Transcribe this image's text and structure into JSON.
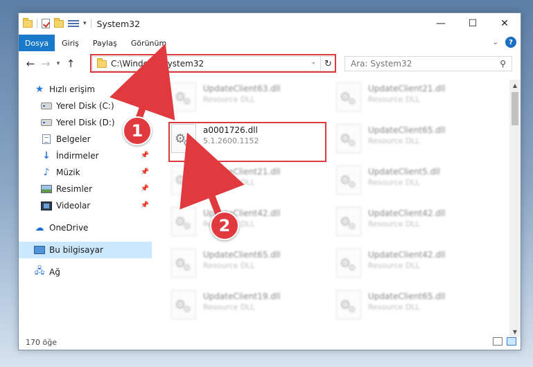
{
  "window": {
    "title": "System32",
    "controls": {
      "minimize": "—",
      "maximize": "☐",
      "close": "✕"
    }
  },
  "ribbon": {
    "tabs": [
      "Dosya",
      "Giriş",
      "Paylaş",
      "Görünüm"
    ],
    "help": "?"
  },
  "address": {
    "path": "C:\\Windows\\System32",
    "search_placeholder": "Ara: System32"
  },
  "sidebar": {
    "items": [
      {
        "label": "Hızlı erişim",
        "icon": "star-icon"
      },
      {
        "label": "Yerel Disk (C:)",
        "icon": "disk-icon"
      },
      {
        "label": "Yerel Disk (D:)",
        "icon": "disk-icon"
      },
      {
        "label": "Belgeler",
        "icon": "documents-icon"
      },
      {
        "label": "İndirmeler",
        "icon": "download-icon"
      },
      {
        "label": "Müzik",
        "icon": "music-icon"
      },
      {
        "label": "Resimler",
        "icon": "pictures-icon"
      },
      {
        "label": "Videolar",
        "icon": "videos-icon"
      },
      {
        "label": "OneDrive",
        "icon": "cloud-icon"
      },
      {
        "label": "Bu bilgisayar",
        "icon": "computer-icon"
      },
      {
        "label": "Ağ",
        "icon": "network-icon"
      }
    ]
  },
  "files": {
    "left": [
      {
        "name": "UpdateClient63.dll",
        "sub": "Resource DLL"
      },
      {
        "name": "a0001726.dll",
        "sub": "5.1.2600.1152"
      },
      {
        "name": "UpdateClient21.dll",
        "sub": "Resource DLL"
      },
      {
        "name": "UpdateClient42.dll",
        "sub": "Resource DLL"
      },
      {
        "name": "UpdateClient65.dll",
        "sub": "Resource DLL"
      },
      {
        "name": "UpdateClient19.dll",
        "sub": "Resource DLL"
      }
    ],
    "right": [
      {
        "name": "UpdateClient21.dll",
        "sub": "Resource DLL"
      },
      {
        "name": "UpdateClient65.dll",
        "sub": "Resource DLL"
      },
      {
        "name": "UpdateClient5.dll",
        "sub": "Resource DLL"
      },
      {
        "name": "UpdateClient42.dll",
        "sub": "Resource DLL"
      },
      {
        "name": "UpdateClient42.dll",
        "sub": "Resource DLL"
      },
      {
        "name": "UpdateClient65.dll",
        "sub": "Resource DLL"
      }
    ]
  },
  "status": {
    "count": "170 öğe"
  },
  "callouts": {
    "one": "1",
    "two": "2"
  },
  "colors": {
    "accent": "#1979ca",
    "highlight": "#d9393f",
    "badge": "#e03a3e"
  }
}
